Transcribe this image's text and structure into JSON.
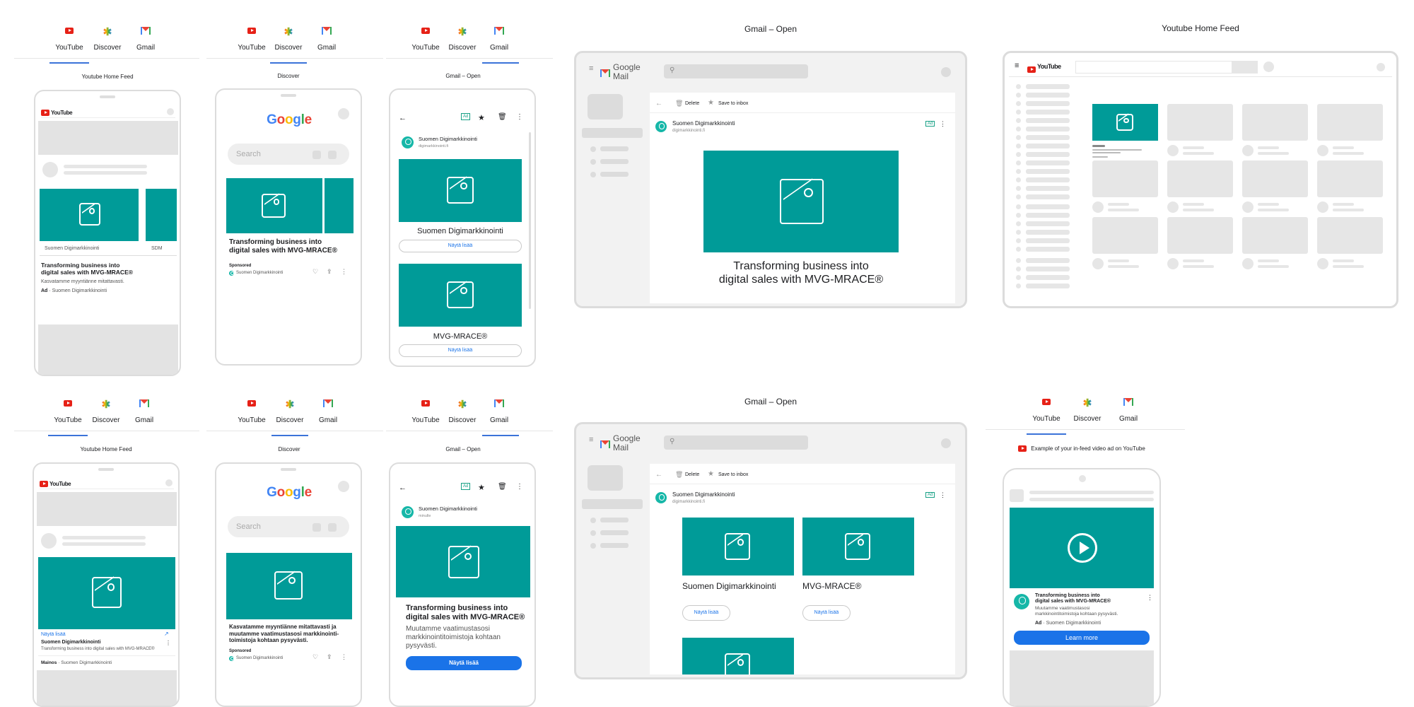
{
  "tabs": {
    "youtube": "YouTube",
    "discover": "Discover",
    "gmail": "Gmail"
  },
  "titles": {
    "yt_home": "Youtube Home Feed",
    "discover": "Discover",
    "gmail_open": "Gmail – Open",
    "gmail_open_dash": "Gmail – Open",
    "yt_home_desk": "Youtube Home Feed",
    "infeed": "Example of your in-feed video ad on YouTube"
  },
  "brand": {
    "youtube": "YouTube",
    "google": "Google",
    "google_mail": "Google Mail"
  },
  "advertiser": "Suomen Digimarkkinointi",
  "advertiser_short": "SDM",
  "advertiser_email": "digimarkkinointi.fi",
  "headline": "Transforming business into digital sales with MVG-MRACE®",
  "headline_l1": "Transforming business into",
  "headline_l2": "digital sales with MVG-MRACE®",
  "desc_short": "Kasvatamme myyntiänne mitattavasti.",
  "desc_long": "Kasvatamme myyntiänne mitattavasti ja muutamme vaatimustasosi markkinointi-toimistoja kohtaan pysyvästi.",
  "desc_gmail": "Muutamme vaatimustasosi markkinointitoimistoja kohtaan pysyvästi.",
  "desc_infeed": "Muutamme vaatimustasosi markkinointitoimistoja kohtaan pysyvästi.",
  "ad_label": "Ad",
  "ad_sep": "·",
  "mainos": "Mainos",
  "sponsored": "Sponsored",
  "search_placeholder": "Search",
  "cta_more": "Näytä lisää",
  "cta_learn": "Learn more",
  "product": "MVG-MRACE®",
  "toolbar": {
    "delete": "Delete",
    "save": "Save to inbox"
  },
  "ad_badge": "Ad",
  "sender_short": "minulle",
  "colors": {
    "teal": "#009b98",
    "blue": "#1a73e8",
    "youtube_red": "#e62117"
  }
}
